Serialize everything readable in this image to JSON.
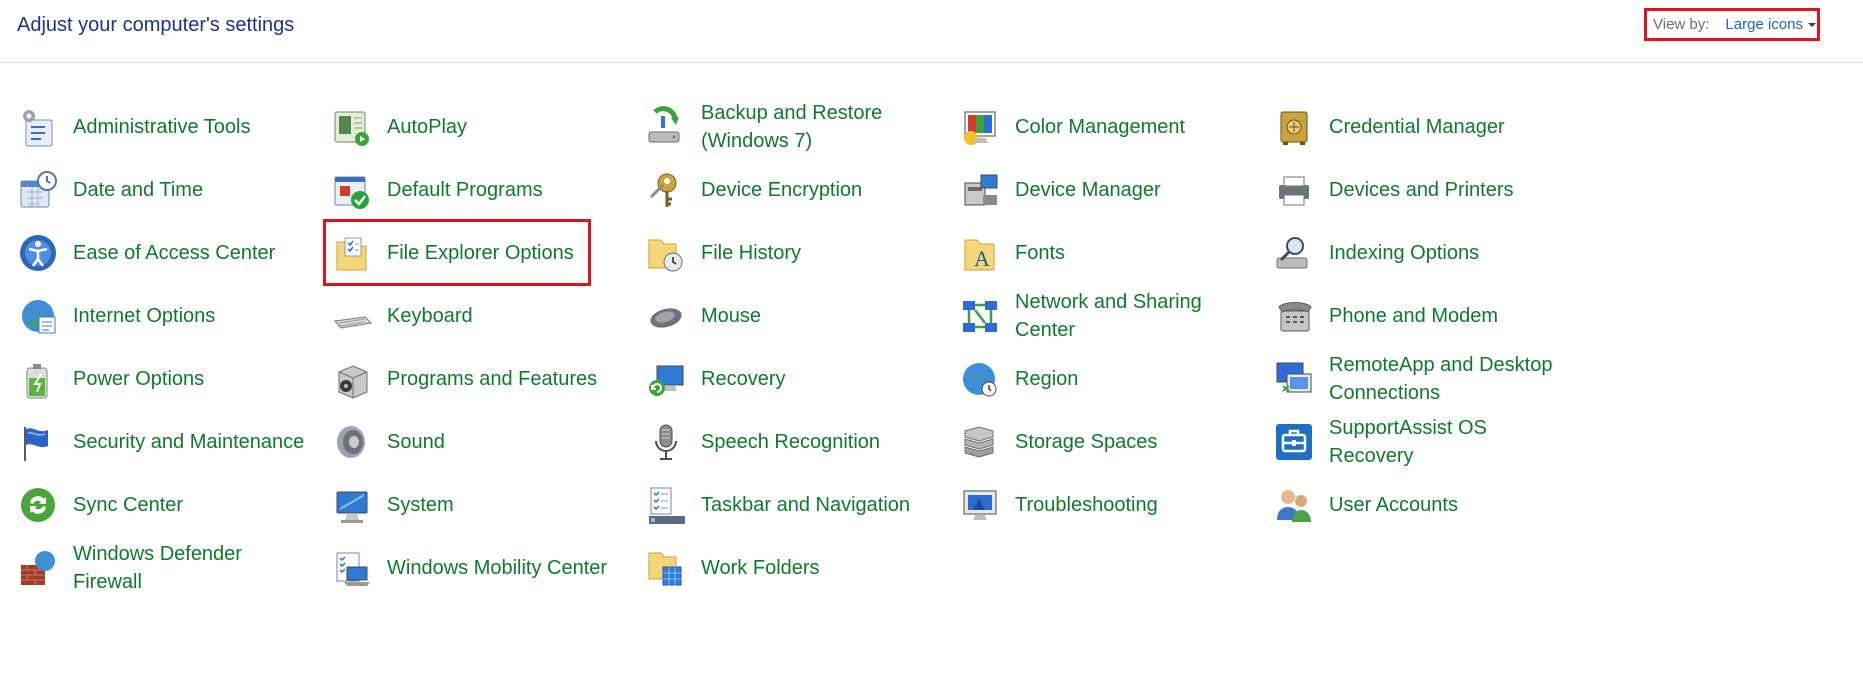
{
  "header": {
    "title": "Adjust your computer's settings",
    "view_by_label": "View by:",
    "view_by_value": "Large icons"
  },
  "columns": [
    [
      {
        "label": "Administrative Tools",
        "icon": "admin-tools-icon"
      },
      {
        "label": "Date and Time",
        "icon": "calendar-clock-icon"
      },
      {
        "label": "Ease of Access Center",
        "icon": "ease-of-access-icon"
      },
      {
        "label": "Internet Options",
        "icon": "globe-icon"
      },
      {
        "label": "Power Options",
        "icon": "battery-icon"
      },
      {
        "label": "Security and Maintenance",
        "icon": "flag-icon"
      },
      {
        "label": "Sync Center",
        "icon": "sync-icon"
      },
      {
        "label": "Windows Defender\nFirewall",
        "icon": "firewall-icon"
      }
    ],
    [
      {
        "label": "AutoPlay",
        "icon": "autoplay-icon"
      },
      {
        "label": "Default Programs",
        "icon": "default-programs-icon"
      },
      {
        "label": "File Explorer Options",
        "icon": "folder-options-icon"
      },
      {
        "label": "Keyboard",
        "icon": "keyboard-icon"
      },
      {
        "label": "Programs and Features",
        "icon": "programs-box-icon"
      },
      {
        "label": "Sound",
        "icon": "speaker-icon"
      },
      {
        "label": "System",
        "icon": "computer-icon"
      },
      {
        "label": "Windows Mobility Center",
        "icon": "laptop-checklist-icon"
      }
    ],
    [
      {
        "label": "Backup and Restore\n(Windows 7)",
        "icon": "backup-drive-icon"
      },
      {
        "label": "Device Encryption",
        "icon": "key-icon"
      },
      {
        "label": "File History",
        "icon": "folder-clock-icon"
      },
      {
        "label": "Mouse",
        "icon": "mouse-icon"
      },
      {
        "label": "Recovery",
        "icon": "recovery-monitor-icon"
      },
      {
        "label": "Speech Recognition",
        "icon": "microphone-icon"
      },
      {
        "label": "Taskbar and Navigation",
        "icon": "taskbar-icon"
      },
      {
        "label": "Work Folders",
        "icon": "folder-cube-icon"
      }
    ],
    [
      {
        "label": "Color Management",
        "icon": "color-monitor-icon"
      },
      {
        "label": "Device Manager",
        "icon": "device-manager-icon"
      },
      {
        "label": "Fonts",
        "icon": "fonts-folder-icon"
      },
      {
        "label": "Network and Sharing\nCenter",
        "icon": "network-icon"
      },
      {
        "label": "Region",
        "icon": "globe-clock-icon"
      },
      {
        "label": "Storage Spaces",
        "icon": "storage-drives-icon"
      },
      {
        "label": "Troubleshooting",
        "icon": "troubleshoot-monitor-icon"
      }
    ],
    [
      {
        "label": "Credential Manager",
        "icon": "vault-icon"
      },
      {
        "label": "Devices and Printers",
        "icon": "printer-icon"
      },
      {
        "label": "Indexing Options",
        "icon": "magnifier-drive-icon"
      },
      {
        "label": "Phone and Modem",
        "icon": "phone-icon"
      },
      {
        "label": "RemoteApp and Desktop\nConnections",
        "icon": "remote-desktop-icon"
      },
      {
        "label": "SupportAssist OS\nRecovery",
        "icon": "supportassist-icon"
      },
      {
        "label": "User Accounts",
        "icon": "users-icon"
      }
    ]
  ],
  "colors": {
    "link_green": "#0f7a2e",
    "title_blue": "#1e3287",
    "highlight_red": "#e0141e"
  }
}
